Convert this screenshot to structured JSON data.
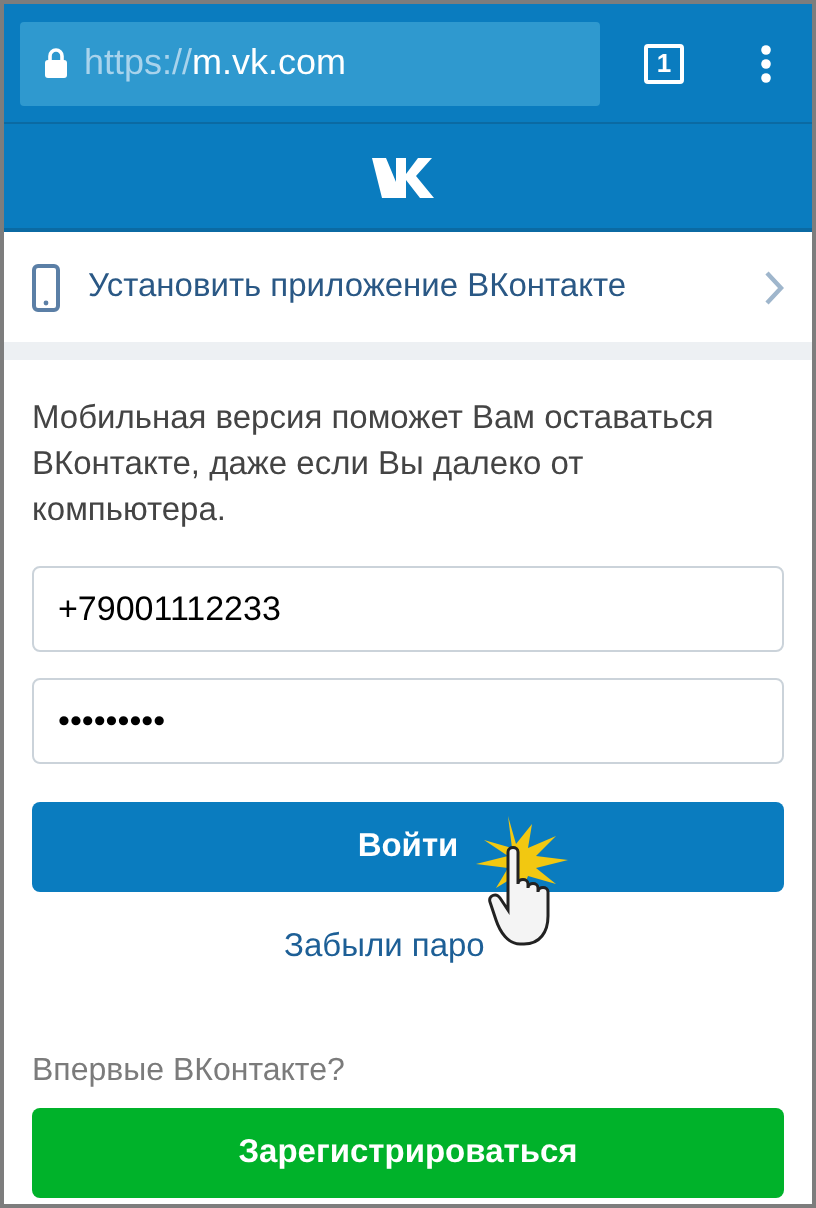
{
  "browser": {
    "url_scheme": "https://",
    "url_host": "m.vk.com",
    "secure": true,
    "tab_count": "1"
  },
  "install_banner": {
    "label": "Установить приложение ВКонтакте"
  },
  "intro": "Мобильная версия поможет Вам оставаться ВКонтакте, даже если Вы далеко от компьютера.",
  "login_form": {
    "phone": "+79001112233",
    "password": "•••••••••",
    "submit": "Войти",
    "forgot_link": "Забыли паро"
  },
  "signup": {
    "prompt": "Впервые ВКонтакте?",
    "button": "Зарегистрироваться"
  }
}
